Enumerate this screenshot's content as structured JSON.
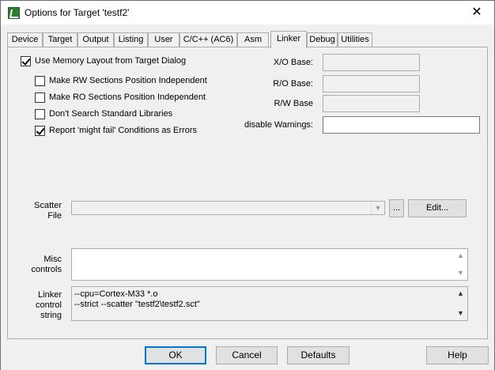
{
  "window": {
    "title": "Options for Target 'testf2'",
    "close_glyph": "✕"
  },
  "tabs": [
    {
      "label": "Device"
    },
    {
      "label": "Target"
    },
    {
      "label": "Output"
    },
    {
      "label": "Listing"
    },
    {
      "label": "User"
    },
    {
      "label": "C/C++ (AC6)"
    },
    {
      "label": "Asm"
    },
    {
      "label": "Linker",
      "active": true
    },
    {
      "label": "Debug"
    },
    {
      "label": "Utilities"
    }
  ],
  "options": {
    "use_memory_layout": {
      "label": "Use Memory Layout from Target Dialog",
      "checked": true
    },
    "rw_independent": {
      "label": "Make RW Sections Position Independent",
      "checked": false
    },
    "ro_independent": {
      "label": "Make RO Sections Position Independent",
      "checked": false
    },
    "dont_search_libs": {
      "label": "Don't Search Standard Libraries",
      "checked": false
    },
    "might_fail_errors": {
      "label": "Report 'might fail' Conditions as Errors",
      "checked": true
    }
  },
  "fields": {
    "xo_base": {
      "label": "X/O Base:",
      "value": ""
    },
    "ro_base": {
      "label": "R/O Base:",
      "value": ""
    },
    "rw_base": {
      "label": "R/W Base",
      "value": ""
    },
    "disable_warnings": {
      "label": "disable Warnings:",
      "value": ""
    }
  },
  "scatter": {
    "label_line1": "Scatter",
    "label_line2": "File",
    "value": "",
    "browse_label": "...",
    "edit_label": "Edit..."
  },
  "misc": {
    "label_line1": "Misc",
    "label_line2": "controls",
    "value": ""
  },
  "linker_string": {
    "label_line1": "Linker",
    "label_line2": "control",
    "label_line3": "string",
    "lines": [
      "--cpu=Cortex-M33 *.o",
      "--strict --scatter \"testf2\\testf2.sct\""
    ]
  },
  "buttons": {
    "ok": "OK",
    "cancel": "Cancel",
    "defaults": "Defaults",
    "help": "Help"
  },
  "icons": {
    "app": "keil-uvision-icon",
    "scroll_up": "▲",
    "scroll_down": "▼",
    "combo_arrow": "▼"
  }
}
